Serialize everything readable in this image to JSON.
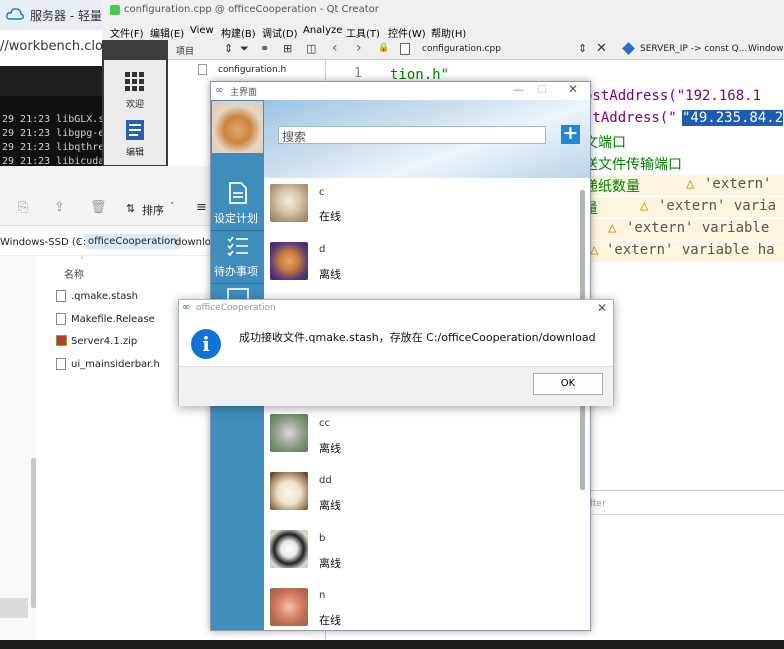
{
  "browser": {
    "tab_title": "服务器 - 轻量应",
    "url": "//workbench.cloud",
    "terminal_lines": [
      "29 21:23 libGLX.s",
      "29 21:23 libgpg-e",
      "29 21:23 libqthre",
      "29 21:23 libicuda"
    ]
  },
  "explorer": {
    "sort_label": "排序",
    "path": [
      "Windows-SSD (C:)",
      "officeCooperation",
      "download"
    ],
    "column_name": "名称",
    "files": [
      ".qmake.stash",
      "Makefile.Release",
      "Server4.1.zip",
      "ui_mainsiderbar.h"
    ]
  },
  "qt": {
    "title": "configuration.cpp @ officeCooperation - Qt Creator",
    "menus": [
      "文件(F)",
      "编辑(E)",
      "View",
      "构建(B)",
      "调试(D)",
      "Analyze",
      "工具(T)",
      "控件(W)",
      "帮助(H)"
    ],
    "project_selector": "项目",
    "open_file": "configuration.cpp",
    "symbol": "SERVER_IP -> const Q...",
    "window_label": "Window",
    "left_modes": [
      "欢迎",
      "编辑"
    ],
    "tree_files": [
      "configuration.h"
    ],
    "line_number": "1",
    "code_lines": [
      "tion.h\"",
      "ostAddress(\"192.168.1",
      "stAddress(\"",
      "\"49.235.84.2",
      "文端口",
      "送文件传输端口",
      "递纸数量",
      "量"
    ],
    "warnings": [
      "'extern' ",
      "'extern' varia",
      "'extern' variable",
      "'extern' variable ha"
    ],
    "filter_placeholder": "ilter"
  },
  "chat": {
    "window_title": "主界面",
    "search_placeholder": "搜索",
    "add_button": "+",
    "nav": [
      {
        "label": "设定计划",
        "icon": "document-icon"
      },
      {
        "label": "待办事项",
        "icon": "checklist-icon"
      }
    ],
    "contacts": [
      {
        "name": "c",
        "status": "在线"
      },
      {
        "name": "d",
        "status": "离线"
      },
      {
        "name": "cc",
        "status": "离线"
      },
      {
        "name": "dd",
        "status": "离线"
      },
      {
        "name": "b",
        "status": "离线"
      },
      {
        "name": "n",
        "status": "在线"
      }
    ]
  },
  "dialog": {
    "title": "officeCooperation",
    "message": "成功接收文件.qmake.stash，存放在 C:/officeCooperation/download",
    "ok_label": "OK"
  },
  "colors": {
    "chat_sidebar": "#3f8dbd",
    "info_icon": "#1173d4",
    "code_string": "#008000",
    "code_purple": "#800080",
    "selection": "#1e5cb3"
  }
}
